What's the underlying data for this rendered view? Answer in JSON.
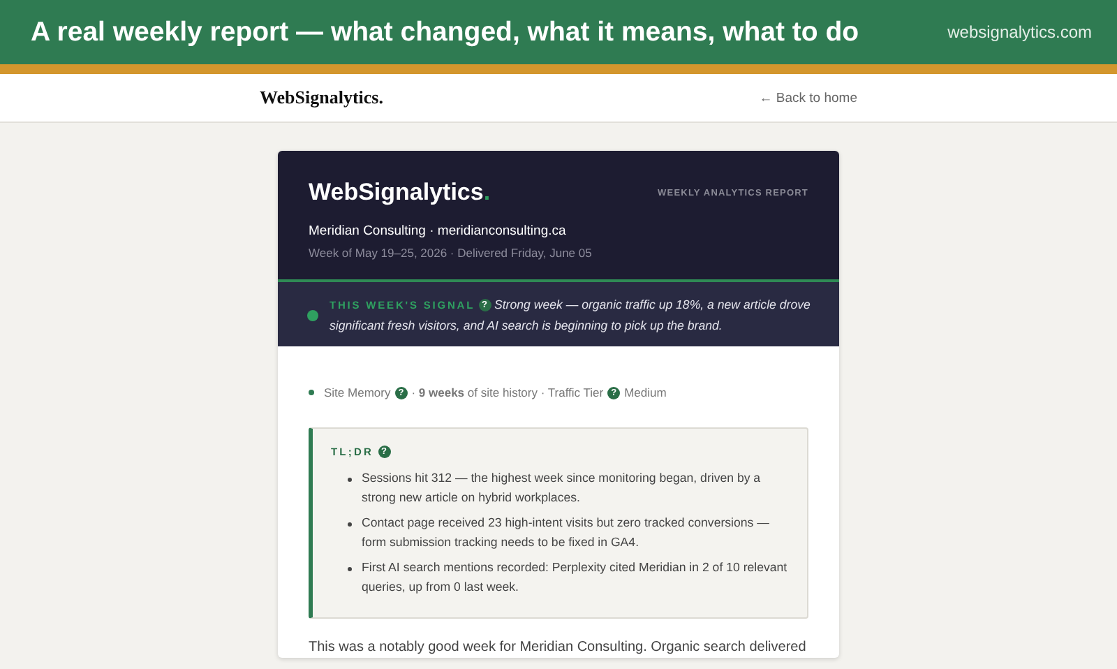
{
  "banner": {
    "title": "A real weekly report — what changed, what it means, what to do",
    "site": "websignalytics.com"
  },
  "nav": {
    "logo": "WebSignalytics.",
    "back_link": "← Back to home"
  },
  "report": {
    "logo": "WebSignalytics",
    "logo_mark": ".",
    "kicker": "WEEKLY ANALYTICS REPORT",
    "client": "Meridian Consulting · meridianconsulting.ca",
    "period": "Week of May 19–25, 2026 · Delivered Friday, June 05",
    "signal": {
      "label": "THIS WEEK'S SIGNAL",
      "help": "?",
      "text": "Strong week — organic traffic up 18%, a new article drove significant fresh visitors, and AI search is beginning to pick up the brand."
    },
    "meta": [
      {
        "text": "Site Memory",
        "help": "?"
      },
      {
        "text": "· **9 weeks** of site history · Traffic Tier",
        "help": "?"
      },
      {
        "text": "Medium"
      }
    ],
    "tldr": {
      "title": "TL;DR",
      "help": "?",
      "items": [
        "Sessions hit 312 — the highest week since monitoring began, driven by a strong new article on hybrid workplaces.",
        "Contact page received 23 high-intent visits but zero tracked conversions — form submission tracking needs to be fixed in GA4.",
        "First AI search mentions recorded: Perplexity cited Meridian in 2 of 10 relevant queries, up from 0 last week."
      ]
    },
    "intro": "This was a notably good week for Meridian Consulting. Organic search delivered"
  }
}
